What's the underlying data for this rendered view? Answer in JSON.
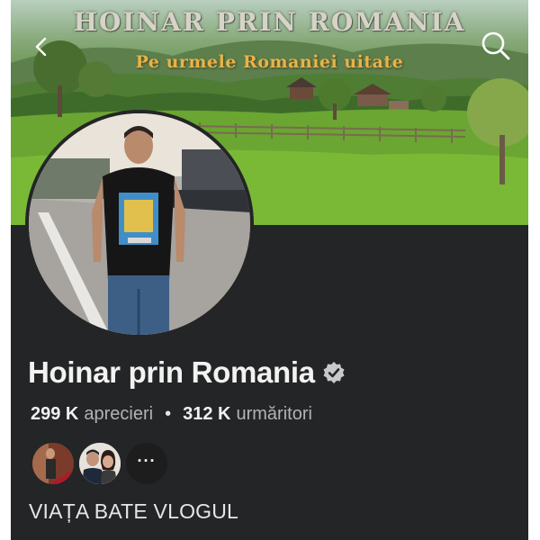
{
  "cover": {
    "title": "HOINAR PRIN ROMANIA",
    "subtitle": "Pe urmele Romaniei uitate"
  },
  "icons": {
    "back": "chevron-left-icon",
    "search": "search-icon",
    "verified": "verified-badge-icon"
  },
  "profile": {
    "name": "Hoinar prin Romania",
    "likes_count": "299 K",
    "likes_label": "aprecieri",
    "separator": "•",
    "followers_count": "312 K",
    "followers_label": "urmăritori",
    "more_label": "···",
    "intro": "VIAȚA BATE VLOGUL"
  },
  "colors": {
    "background": "#242526",
    "text_primary": "#f2f2f2",
    "text_secondary": "#b0b3b8",
    "subtitle_gold": "#e7b34a"
  }
}
